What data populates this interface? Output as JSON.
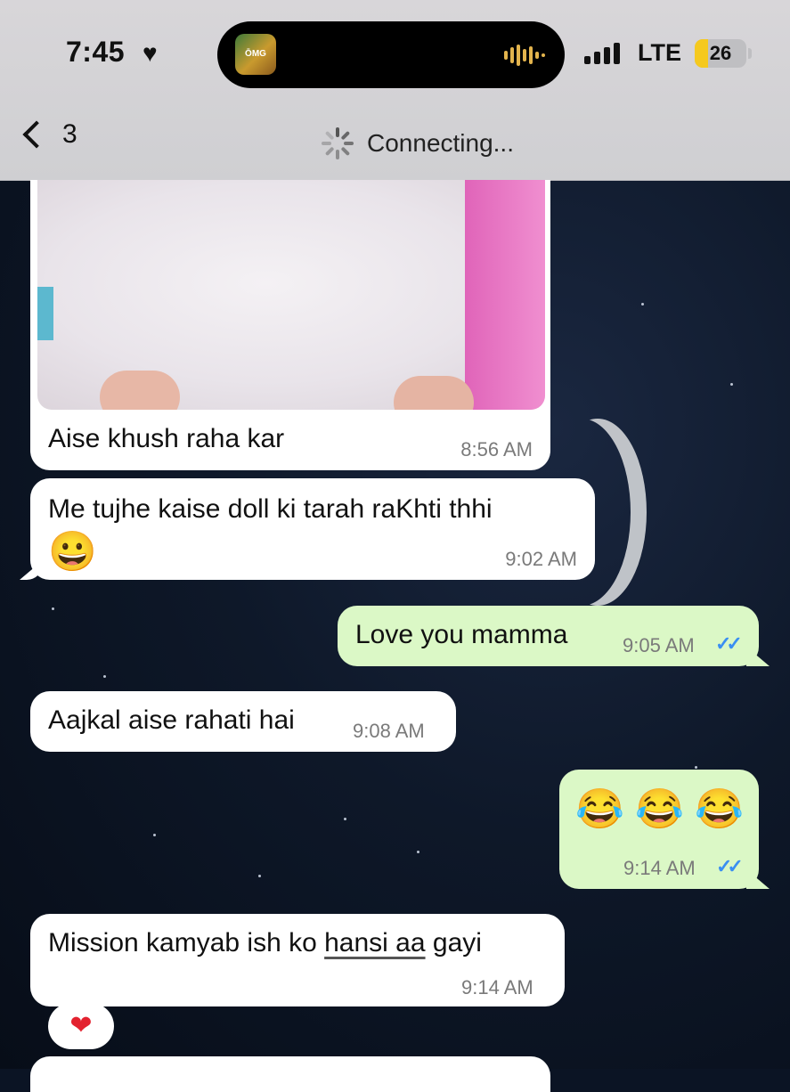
{
  "status_bar": {
    "time": "7:45",
    "heart": "♥",
    "network": "LTE",
    "battery": "26",
    "battery_level": 0.26,
    "app_icon_text": "ŌMG"
  },
  "header": {
    "back_count": "3",
    "status": "Connecting..."
  },
  "messages": [
    {
      "text": "Aise khush raha kar",
      "time": "8:56 AM"
    },
    {
      "text": "Me tujhe kaise doll ki tarah raKhti thhi",
      "emoji": "😀",
      "time": "9:02 AM"
    },
    {
      "text": "Love you mamma",
      "time": "9:05 AM",
      "ticks": "✓✓"
    },
    {
      "text": "Aajkal aise rahati hai",
      "time": "9:08 AM"
    },
    {
      "emoji": "😂 😂 😂",
      "time": "9:14 AM",
      "ticks": "✓✓"
    },
    {
      "text_pre": "Mission kamyab ish ko ",
      "text_link": "hansi aa",
      "text_post": " gayi",
      "time": "9:14 AM",
      "reaction": "❤"
    }
  ],
  "colors": {
    "incoming_bubble": "#ffffff",
    "outgoing_bubble": "#dbf8c6",
    "read_ticks": "#3a8ff2",
    "battery_fill": "#f5c91e"
  }
}
